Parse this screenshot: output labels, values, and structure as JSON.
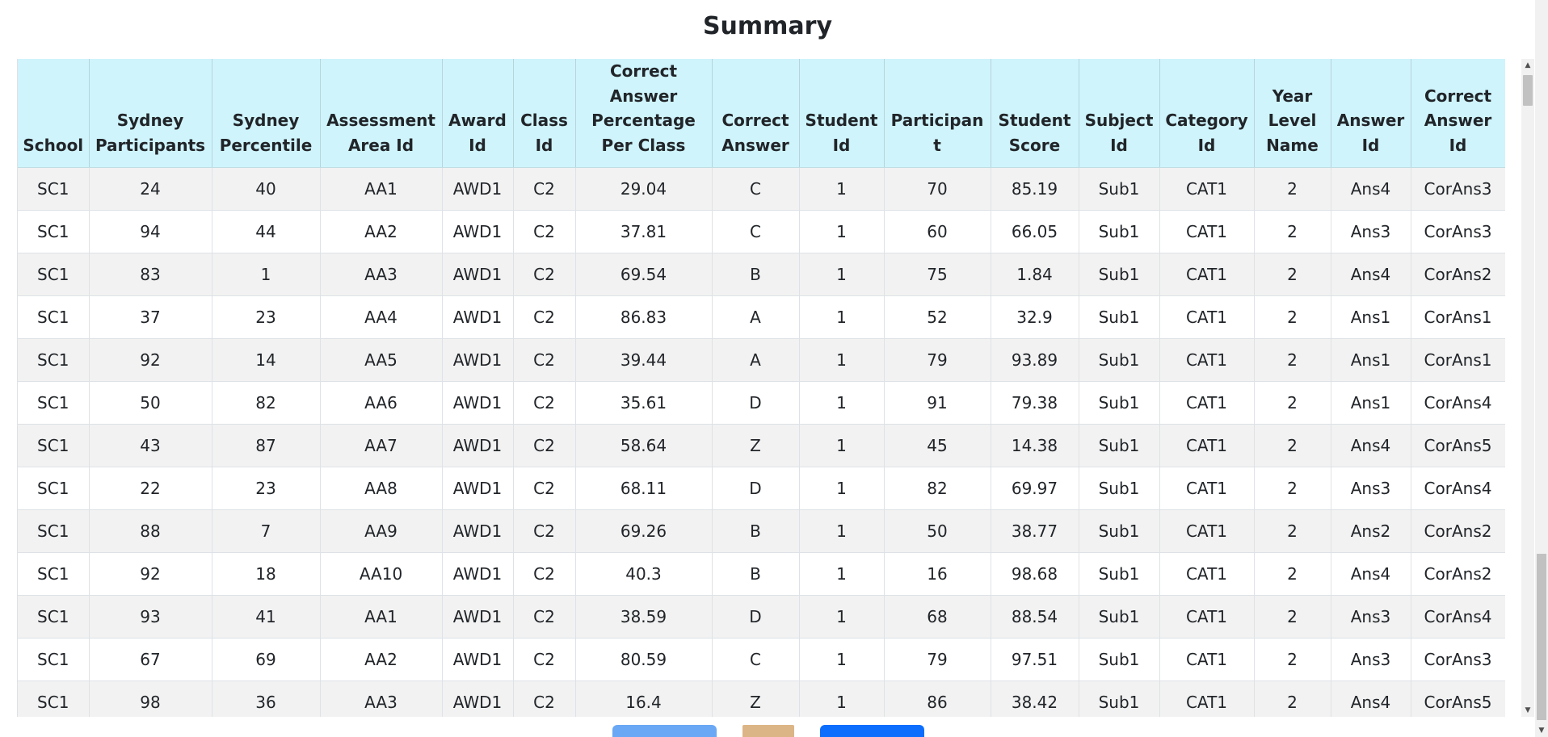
{
  "page": {
    "title": "Summary"
  },
  "table": {
    "headers": [
      "School",
      "Sydney Participants",
      "Sydney Percentile",
      "Assessment Area Id",
      "Award Id",
      "Class Id",
      "Correct Answer Percentage Per Class",
      "Correct Answer",
      "Student Id",
      "Participant",
      "Student Score",
      "Subject Id",
      "Category Id",
      "Year Level Name",
      "Answer Id",
      "Correct Answer Id"
    ],
    "rows": [
      [
        "SC1",
        "24",
        "40",
        "AA1",
        "AWD1",
        "C2",
        "29.04",
        "C",
        "1",
        "70",
        "85.19",
        "Sub1",
        "CAT1",
        "2",
        "Ans4",
        "CorAns3"
      ],
      [
        "SC1",
        "94",
        "44",
        "AA2",
        "AWD1",
        "C2",
        "37.81",
        "C",
        "1",
        "60",
        "66.05",
        "Sub1",
        "CAT1",
        "2",
        "Ans3",
        "CorAns3"
      ],
      [
        "SC1",
        "83",
        "1",
        "AA3",
        "AWD1",
        "C2",
        "69.54",
        "B",
        "1",
        "75",
        "1.84",
        "Sub1",
        "CAT1",
        "2",
        "Ans4",
        "CorAns2"
      ],
      [
        "SC1",
        "37",
        "23",
        "AA4",
        "AWD1",
        "C2",
        "86.83",
        "A",
        "1",
        "52",
        "32.9",
        "Sub1",
        "CAT1",
        "2",
        "Ans1",
        "CorAns1"
      ],
      [
        "SC1",
        "92",
        "14",
        "AA5",
        "AWD1",
        "C2",
        "39.44",
        "A",
        "1",
        "79",
        "93.89",
        "Sub1",
        "CAT1",
        "2",
        "Ans1",
        "CorAns1"
      ],
      [
        "SC1",
        "50",
        "82",
        "AA6",
        "AWD1",
        "C2",
        "35.61",
        "D",
        "1",
        "91",
        "79.38",
        "Sub1",
        "CAT1",
        "2",
        "Ans1",
        "CorAns4"
      ],
      [
        "SC1",
        "43",
        "87",
        "AA7",
        "AWD1",
        "C2",
        "58.64",
        "Z",
        "1",
        "45",
        "14.38",
        "Sub1",
        "CAT1",
        "2",
        "Ans4",
        "CorAns5"
      ],
      [
        "SC1",
        "22",
        "23",
        "AA8",
        "AWD1",
        "C2",
        "68.11",
        "D",
        "1",
        "82",
        "69.97",
        "Sub1",
        "CAT1",
        "2",
        "Ans3",
        "CorAns4"
      ],
      [
        "SC1",
        "88",
        "7",
        "AA9",
        "AWD1",
        "C2",
        "69.26",
        "B",
        "1",
        "50",
        "38.77",
        "Sub1",
        "CAT1",
        "2",
        "Ans2",
        "CorAns2"
      ],
      [
        "SC1",
        "92",
        "18",
        "AA10",
        "AWD1",
        "C2",
        "40.3",
        "B",
        "1",
        "16",
        "98.68",
        "Sub1",
        "CAT1",
        "2",
        "Ans4",
        "CorAns2"
      ],
      [
        "SC1",
        "93",
        "41",
        "AA1",
        "AWD1",
        "C2",
        "38.59",
        "D",
        "1",
        "68",
        "88.54",
        "Sub1",
        "CAT1",
        "2",
        "Ans3",
        "CorAns4"
      ],
      [
        "SC1",
        "67",
        "69",
        "AA2",
        "AWD1",
        "C2",
        "80.59",
        "C",
        "1",
        "79",
        "97.51",
        "Sub1",
        "CAT1",
        "2",
        "Ans3",
        "CorAns3"
      ],
      [
        "SC1",
        "98",
        "36",
        "AA3",
        "AWD1",
        "C2",
        "16.4",
        "Z",
        "1",
        "86",
        "38.42",
        "Sub1",
        "CAT1",
        "2",
        "Ans4",
        "CorAns5"
      ]
    ]
  },
  "colors": {
    "header_bg": "#cff4fc",
    "row_striped": "#f2f2f2",
    "button_primary": "#0d6efd",
    "button_light": "#6aa8f5",
    "button_tan": "#dcb586"
  },
  "icons": {
    "scroll_up": "scroll-up-arrow-icon",
    "scroll_down": "scroll-down-arrow-icon"
  }
}
